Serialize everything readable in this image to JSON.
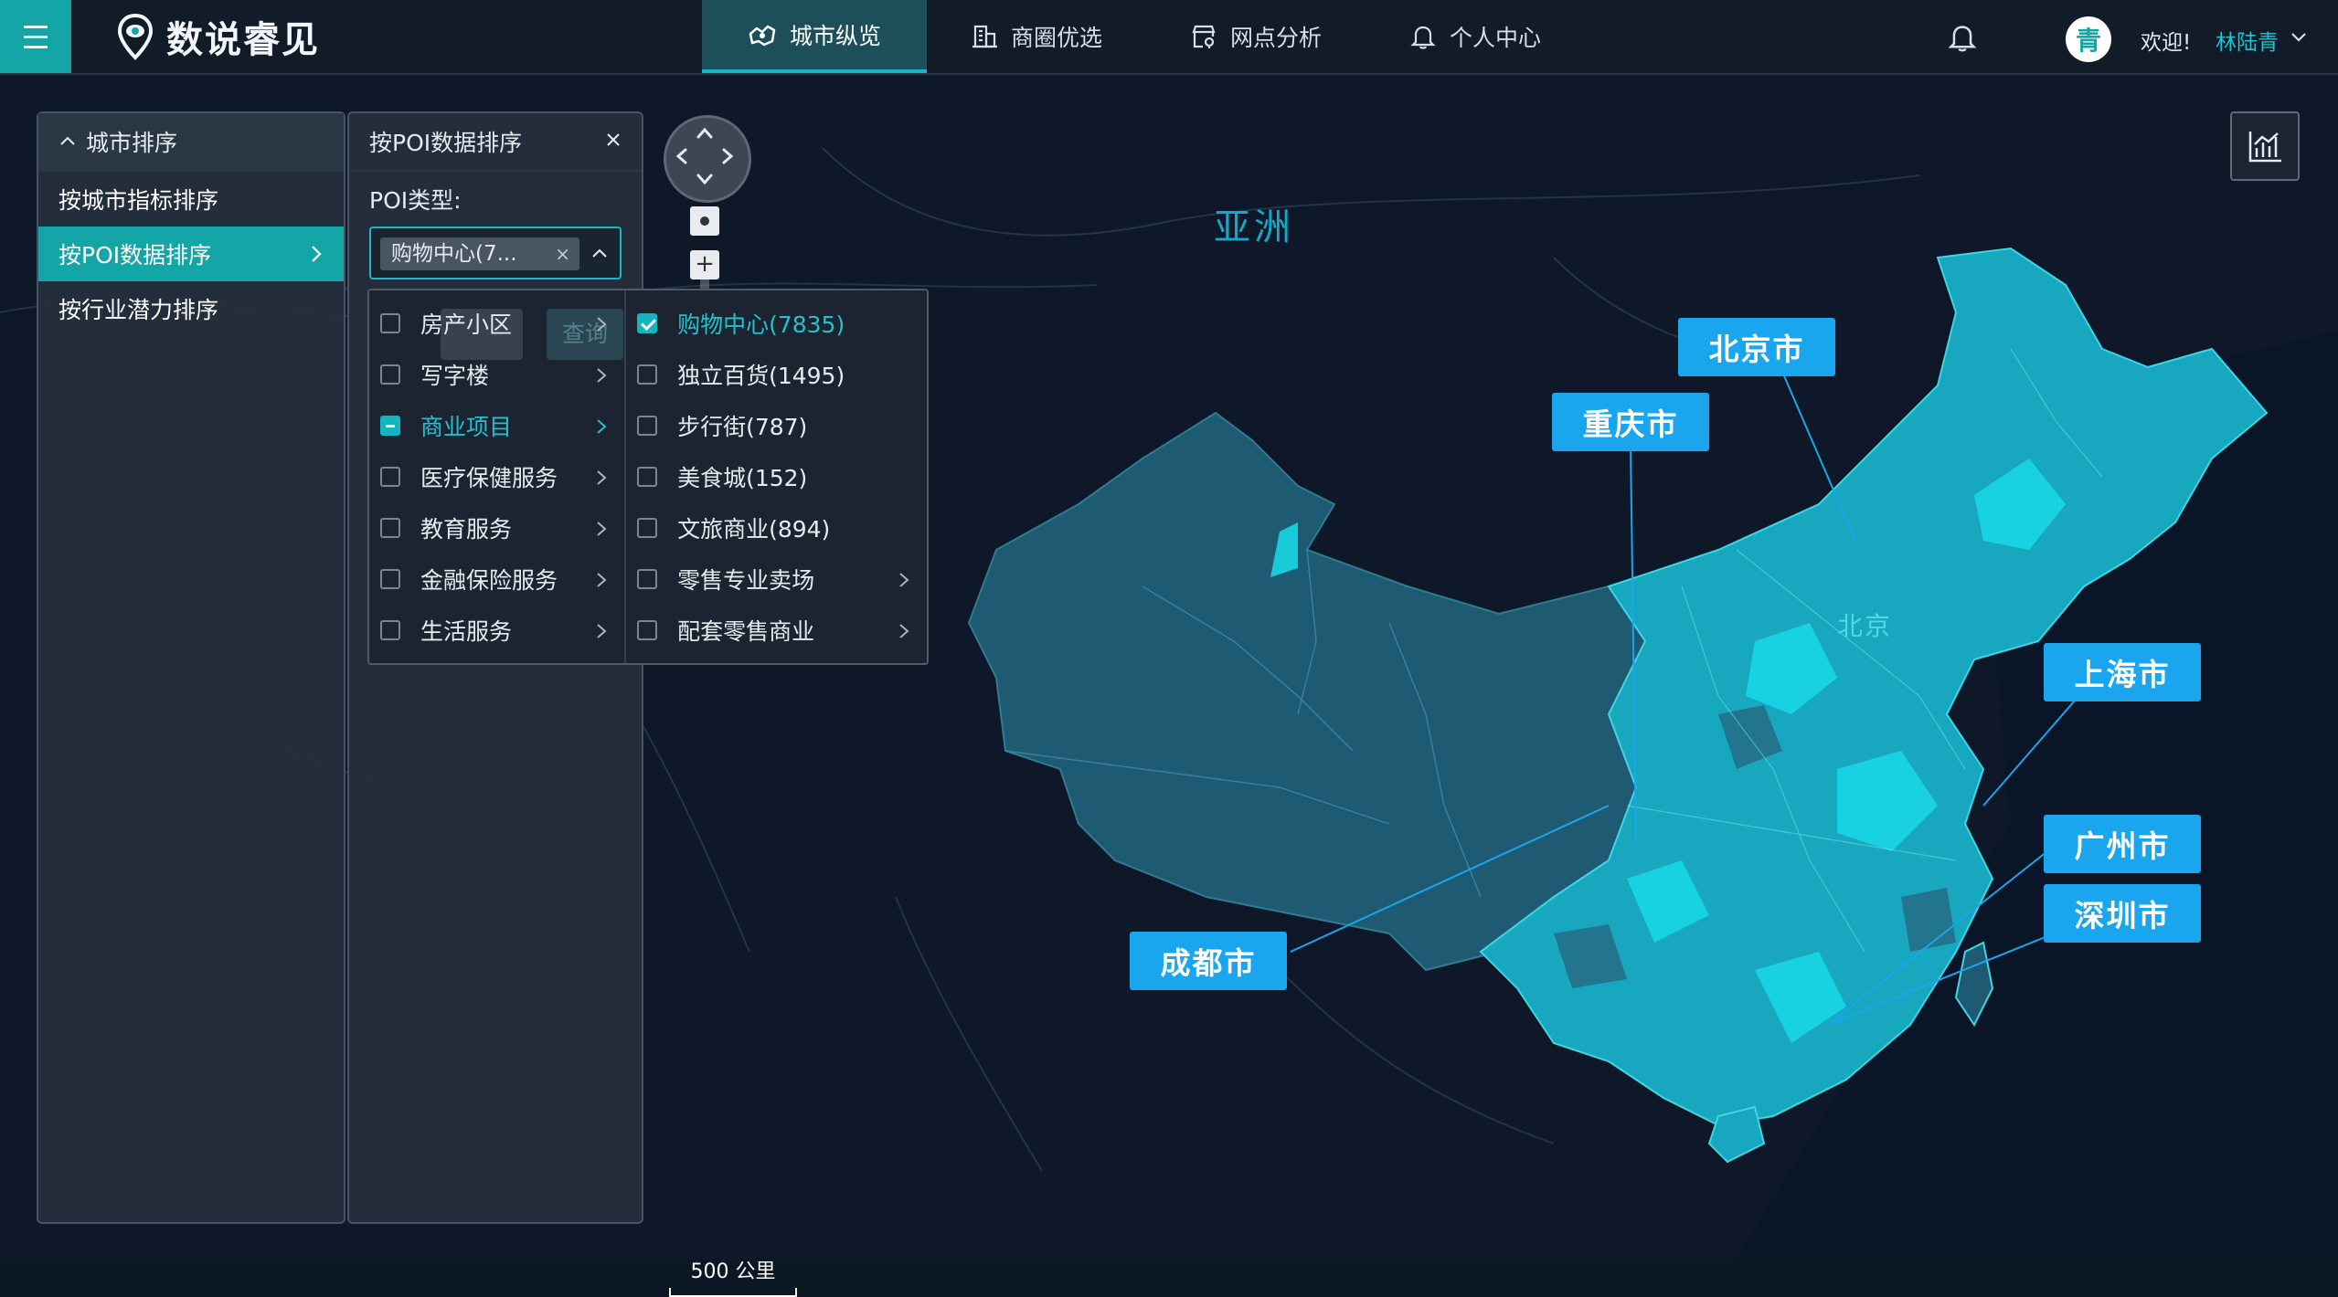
{
  "header": {
    "logo_text": "数说睿见",
    "nav": [
      {
        "label": "城市纵览",
        "icon": "city-map-icon",
        "active": true
      },
      {
        "label": "商圈优选",
        "icon": "building-icon",
        "active": false
      },
      {
        "label": "网点分析",
        "icon": "store-location-icon",
        "active": false
      },
      {
        "label": "个人中心",
        "icon": "bell-outline-icon",
        "active": false
      }
    ],
    "avatar_char": "青",
    "welcome": "欢迎!",
    "username": "林陆青"
  },
  "map": {
    "continent_label": "亚洲",
    "beijing_text": "北京",
    "city_labels": [
      "北京市",
      "重庆市",
      "上海市",
      "广州市",
      "深圳市",
      "成都市"
    ],
    "scale_text": "500 公里"
  },
  "sidebar": {
    "section_title": "城市排序",
    "items": [
      {
        "label": "按城市指标排序",
        "active": false
      },
      {
        "label": "按POI数据排序",
        "active": true
      },
      {
        "label": "按行业潜力排序",
        "active": false
      }
    ]
  },
  "poi_panel": {
    "title": "按POI数据排序",
    "type_label": "POI类型:",
    "selected_tag": "购物中心(7...",
    "query_button": "查询"
  },
  "cascader": {
    "left": [
      {
        "label": "房产小区",
        "state": "unchecked",
        "has_children": true
      },
      {
        "label": "写字楼",
        "state": "unchecked",
        "has_children": true
      },
      {
        "label": "商业项目",
        "state": "indeterminate",
        "has_children": true,
        "highlight": true
      },
      {
        "label": "医疗保健服务",
        "state": "unchecked",
        "has_children": true
      },
      {
        "label": "教育服务",
        "state": "unchecked",
        "has_children": true
      },
      {
        "label": "金融保险服务",
        "state": "unchecked",
        "has_children": true
      },
      {
        "label": "生活服务",
        "state": "unchecked",
        "has_children": true
      }
    ],
    "right": [
      {
        "label": "购物中心(7835)",
        "state": "checked",
        "has_children": false,
        "highlight": true
      },
      {
        "label": "独立百货(1495)",
        "state": "unchecked",
        "has_children": false
      },
      {
        "label": "步行街(787)",
        "state": "unchecked",
        "has_children": false
      },
      {
        "label": "美食城(152)",
        "state": "unchecked",
        "has_children": false
      },
      {
        "label": "文旅商业(894)",
        "state": "unchecked",
        "has_children": false
      },
      {
        "label": "零售专业卖场",
        "state": "unchecked",
        "has_children": true
      },
      {
        "label": "配套零售商业",
        "state": "unchecked",
        "has_children": true
      }
    ]
  },
  "colors": {
    "accent": "#14a6a6",
    "city_label_bg": "#19a6ee",
    "map_bg": "#0c1726",
    "province_dark": "#1f5f7a",
    "province_bright": "#17c6d8"
  }
}
